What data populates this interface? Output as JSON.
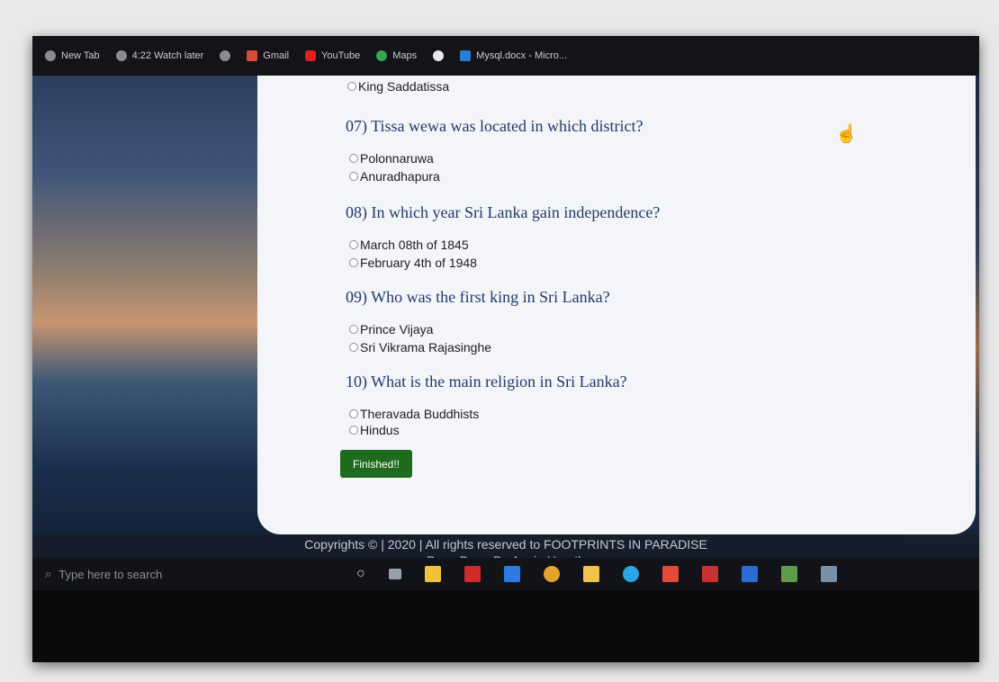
{
  "bookmarks": [
    {
      "label": "New Tab",
      "icon": "globe-icon",
      "color": "#8a8c93"
    },
    {
      "label": "4:22 Watch later",
      "icon": "globe-icon",
      "color": "#8a8c93"
    },
    {
      "label": "",
      "icon": "globe-icon",
      "color": "#8a8c93"
    },
    {
      "label": "Gmail",
      "icon": "gmail-icon",
      "color": "#d64a3a"
    },
    {
      "label": "YouTube",
      "icon": "youtube-icon",
      "color": "#e02020"
    },
    {
      "label": "Maps",
      "icon": "maps-icon",
      "color": "#34a853"
    },
    {
      "label": "",
      "icon": "google-icon",
      "color": "#e9e9e9"
    },
    {
      "label": "Mysql.docx - Micro...",
      "icon": "word-icon",
      "color": "#2b7cd3"
    }
  ],
  "quiz": {
    "prev_option": "King Saddatissa",
    "questions": [
      {
        "text": "07) Tissa wewa was located in which district?",
        "options": [
          "Polonnaruwa",
          "Anuradhapura"
        ]
      },
      {
        "text": "08) In which year Sri Lanka gain independence?",
        "options": [
          "March 08th of 1845",
          "February 4th of 1948"
        ]
      },
      {
        "text": "09) Who was the first king in Sri Lanka?",
        "options": [
          "Prince Vijaya",
          "Sri Vikrama Rajasinghe"
        ]
      },
      {
        "text": "10) What is the main religion in Sri Lanka?",
        "options": [
          "Theravada Buddhists",
          "Hindus"
        ]
      }
    ],
    "finish_label": "Finished!!"
  },
  "footer": {
    "copyright": "Copyrights © | 2020 | All rights reserved to FOOTPRINTS IN PARADISE",
    "credit": "Page Done By:Anuja Herath"
  },
  "taskbar": {
    "search_placeholder": "Type here to search",
    "icons": [
      {
        "name": "cortana-icon",
        "color": "#d8d8d8"
      },
      {
        "name": "task-view-icon",
        "color": "#9aa0a8"
      },
      {
        "name": "store-icon",
        "color": "#f0c23a"
      },
      {
        "name": "pdf-icon",
        "color": "#d02a2a"
      },
      {
        "name": "mail-icon",
        "color": "#2c7be5"
      },
      {
        "name": "chrome-icon",
        "color": "#e2a52a"
      },
      {
        "name": "file-explorer-icon",
        "color": "#f2c24a"
      },
      {
        "name": "edge-icon",
        "color": "#2aa4e2"
      },
      {
        "name": "antivirus-icon",
        "color": "#e24a3a"
      },
      {
        "name": "filezilla-icon",
        "color": "#c93030"
      },
      {
        "name": "word-icon",
        "color": "#2b6cd3"
      },
      {
        "name": "app-icon",
        "color": "#5e9b4a"
      },
      {
        "name": "app2-icon",
        "color": "#7a8fa8"
      }
    ]
  }
}
